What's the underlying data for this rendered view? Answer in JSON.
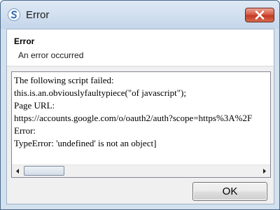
{
  "window": {
    "title": "Error",
    "app_icon": "app-logo-icon",
    "close_icon": "close-icon"
  },
  "header": {
    "heading": "Error",
    "message": "An error occurred"
  },
  "details": {
    "text": "The following script failed:\nthis.is.an.obviouslyfaultypiece(\"of javascript\");\nPage URL:\nhttps://accounts.google.com/o/oauth2/auth?scope=https%3A%2F\nError:\nTypeError: 'undefined' is not an object]",
    "scroll_left_icon": "arrow-left-icon",
    "scroll_right_icon": "arrow-right-icon"
  },
  "footer": {
    "ok_label": "OK"
  },
  "colors": {
    "titlebar": "#c5d6ea",
    "close_button": "#c23a24",
    "content_bg": "#f0f0f0"
  }
}
